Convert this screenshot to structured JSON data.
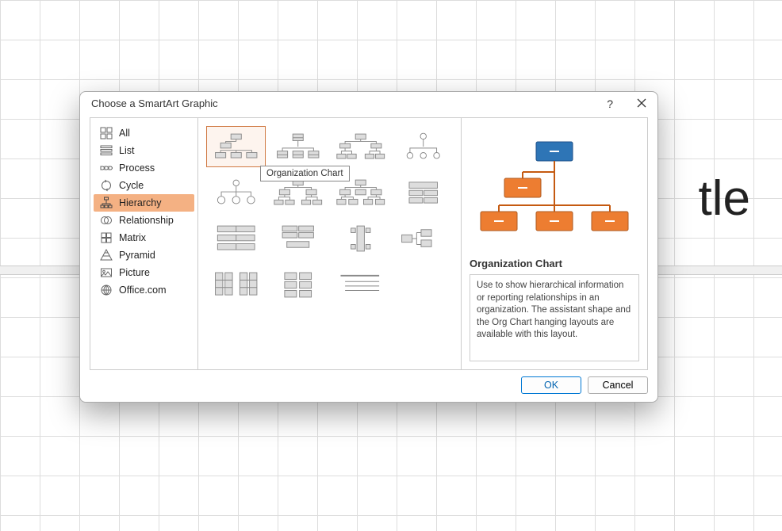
{
  "background": {
    "slide_text_fragment": "tle"
  },
  "dialog": {
    "title": "Choose a SmartArt Graphic",
    "sidebar": {
      "items": [
        {
          "id": "all",
          "label": "All"
        },
        {
          "id": "list",
          "label": "List"
        },
        {
          "id": "process",
          "label": "Process"
        },
        {
          "id": "cycle",
          "label": "Cycle"
        },
        {
          "id": "hierarchy",
          "label": "Hierarchy",
          "selected": true
        },
        {
          "id": "relationship",
          "label": "Relationship"
        },
        {
          "id": "matrix",
          "label": "Matrix"
        },
        {
          "id": "pyramid",
          "label": "Pyramid"
        },
        {
          "id": "picture",
          "label": "Picture"
        },
        {
          "id": "officecom",
          "label": "Office.com"
        }
      ]
    },
    "gallery": {
      "tooltip_text": "Organization Chart",
      "selected_item": "organization-chart"
    },
    "preview": {
      "title": "Organization Chart",
      "description": "Use to show hierarchical information or reporting relationships in an organization. The assistant shape and the Org Chart hanging layouts are available with this layout."
    },
    "buttons": {
      "ok": "OK",
      "cancel": "Cancel"
    },
    "colors": {
      "accent_selected": "#f4b183",
      "preview_top": "#2e75b6",
      "preview_node": "#ed7d31",
      "primary_border": "#0078d4"
    }
  }
}
